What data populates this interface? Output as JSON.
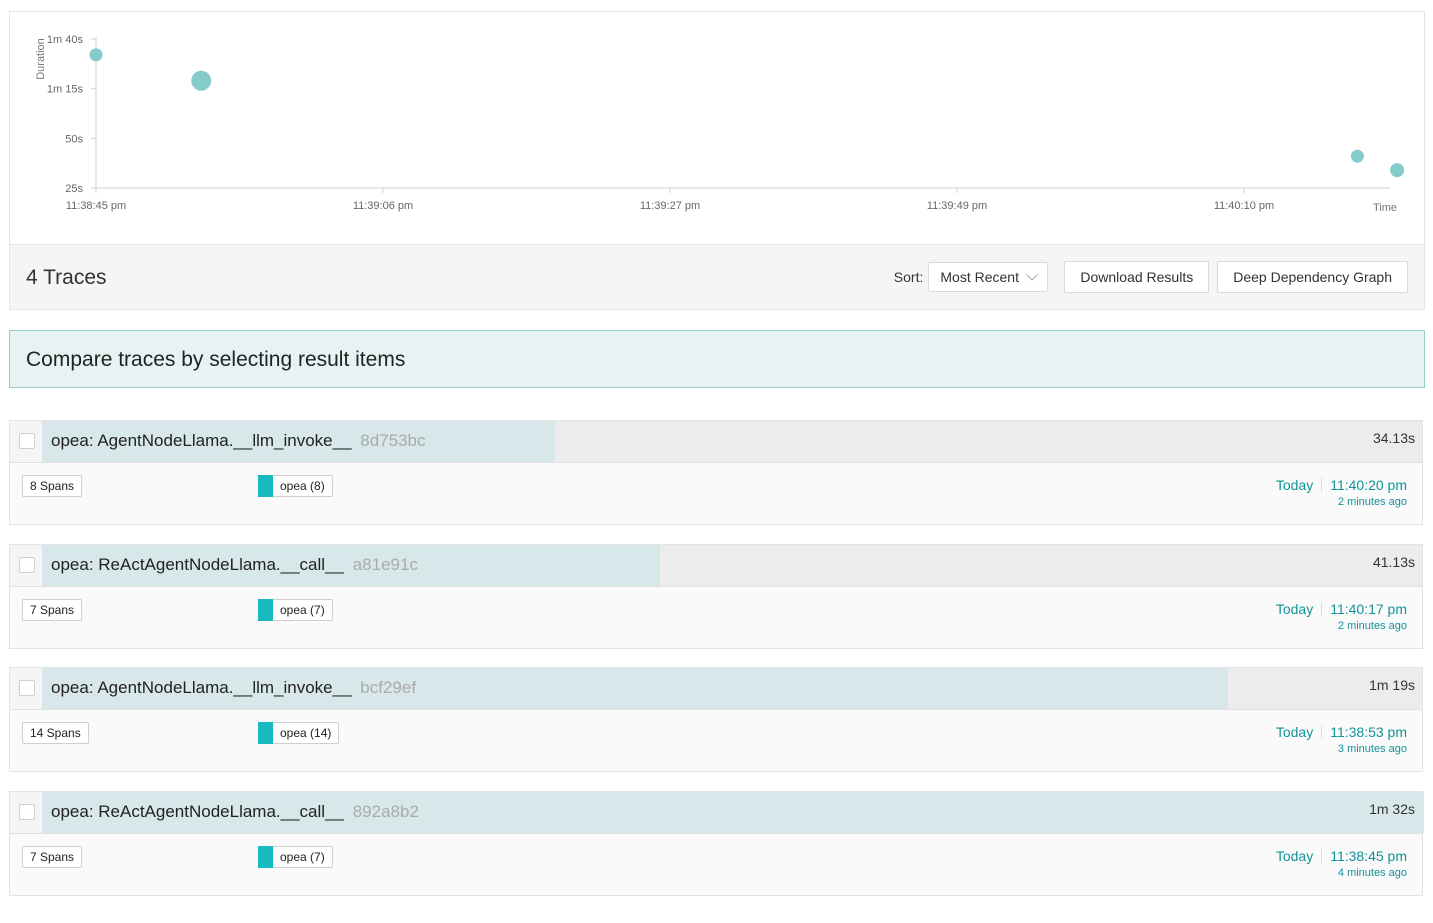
{
  "chart_data": {
    "type": "scatter",
    "xlabel": "Time",
    "ylabel": "Duration",
    "x_ticks": [
      "11:38:45 pm",
      "11:39:06 pm",
      "11:39:27 pm",
      "11:39:49 pm",
      "11:40:10 pm"
    ],
    "y_ticks": [
      "25s",
      "50s",
      "1m 15s",
      "1m 40s"
    ],
    "xlim_seconds": [
      0,
      105
    ],
    "ylim_seconds": [
      25,
      100
    ],
    "grid": false,
    "legend": "none",
    "point_color": "#7ec8c9",
    "points": [
      {
        "x_seconds": 0,
        "y_seconds": 92,
        "spans": 7
      },
      {
        "x_seconds": 7.7,
        "y_seconds": 79,
        "spans": 14
      },
      {
        "x_seconds": 92.3,
        "y_seconds": 41,
        "spans": 7
      },
      {
        "x_seconds": 95.2,
        "y_seconds": 34,
        "spans": 8
      }
    ]
  },
  "header": {
    "count": "4 Traces",
    "sort_label": "Sort:",
    "sort_value": "Most Recent",
    "download_label": "Download Results",
    "graph_label": "Deep Dependency Graph"
  },
  "compare_text": "Compare traces by selecting result items",
  "colors": {
    "service": "#17b8be",
    "bar": "#d8e7ea",
    "accent": "#11939a"
  },
  "traces": [
    {
      "name": "opea: AgentNodeLlama.__llm_invoke__",
      "id": "8d753bc",
      "duration": "34.13s",
      "bar_fraction": 0.371,
      "spans": "8 Spans",
      "service": "opea (8)",
      "day": "Today",
      "time": "11:40:20 pm",
      "ago": "2 minutes ago"
    },
    {
      "name": "opea: ReActAgentNodeLlama.__call__",
      "id": "a81e91c",
      "duration": "41.13s",
      "bar_fraction": 0.447,
      "spans": "7 Spans",
      "service": "opea (7)",
      "day": "Today",
      "time": "11:40:17 pm",
      "ago": "2 minutes ago"
    },
    {
      "name": "opea: AgentNodeLlama.__llm_invoke__",
      "id": "bcf29ef",
      "duration": "1m 19s",
      "bar_fraction": 0.858,
      "spans": "14 Spans",
      "service": "opea (14)",
      "day": "Today",
      "time": "11:38:53 pm",
      "ago": "3 minutes ago"
    },
    {
      "name": "opea: ReActAgentNodeLlama.__call__",
      "id": "892a8b2",
      "duration": "1m 32s",
      "bar_fraction": 1.0,
      "spans": "7 Spans",
      "service": "opea (7)",
      "day": "Today",
      "time": "11:38:45 pm",
      "ago": "4 minutes ago"
    }
  ]
}
